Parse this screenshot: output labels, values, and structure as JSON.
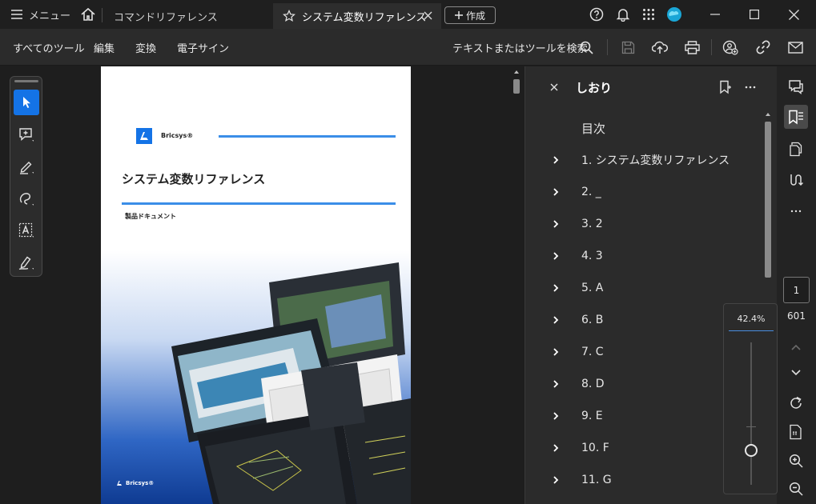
{
  "titlebar": {
    "menu_label": "メニュー",
    "tabs": [
      {
        "label": "コマンドリファレンス",
        "active": false
      },
      {
        "label": "システム変数リファレンス",
        "active": true
      }
    ],
    "create_label": "作成",
    "icons": [
      "hamburger-icon",
      "home-icon",
      "star-icon",
      "close-icon",
      "plus-icon",
      "help-icon",
      "bell-icon",
      "apps-grid-icon",
      "cloud-avatar-icon",
      "minimize-icon",
      "maximize-icon",
      "close-window-icon"
    ]
  },
  "toolbar": {
    "menus": [
      "すべてのツール",
      "編集",
      "変換",
      "電子サイン"
    ],
    "search_label": "テキストまたはツールを検索",
    "icons": [
      "search-icon",
      "save-icon",
      "upload-icon",
      "print-icon",
      "share-user-icon",
      "link-icon",
      "mail-icon"
    ]
  },
  "tool_rail": {
    "tools": [
      "select-cursor-icon",
      "add-comment-icon",
      "highlight-pen-icon",
      "draw-lasso-icon",
      "text-select-icon",
      "signature-pen-icon"
    ]
  },
  "document": {
    "brand_top": "Bricsys®",
    "title": "システム変数リファレンス",
    "subtitle": "製品ドキュメント",
    "brand_bottom": "Bricsys®"
  },
  "bookmarks": {
    "panel_title": "しおり",
    "root": "目次",
    "items": [
      "1. システム変数リファレンス",
      "2. _",
      "3. 2",
      "4. 3",
      "5. A",
      "6. B",
      "7. C",
      "8. D",
      "9. E",
      "10. F",
      "11. G"
    ]
  },
  "right_rail": {
    "icons": [
      "comments-icon",
      "bookmarks-icon",
      "pages-icon",
      "scroll-mode-icon",
      "more-icon"
    ],
    "page_current": "1",
    "page_total": "601",
    "nav_icons": [
      "page-up-icon",
      "page-down-icon",
      "rotate-icon",
      "fit-page-icon",
      "zoom-in-icon",
      "zoom-out-icon"
    ]
  },
  "zoom": {
    "value": "42.4%",
    "level": 0.2
  },
  "colors": {
    "accent": "#1473e6",
    "page_line": "#3b8ee8"
  }
}
